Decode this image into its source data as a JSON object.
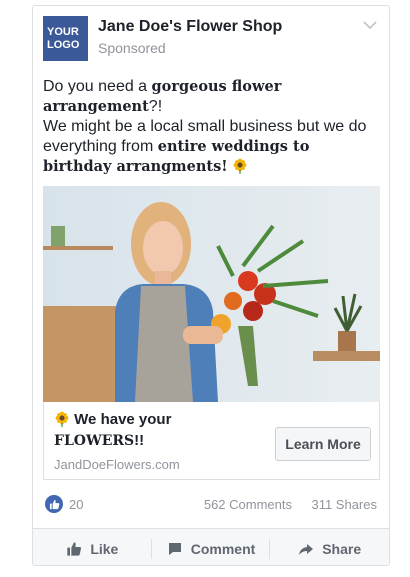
{
  "ad": {
    "logo_line1": "YOUR",
    "logo_line2": "LOGO",
    "page_name": "Jane Doe's Flower Shop",
    "sponsored": "Sponsored",
    "text_1": "Do you need a ",
    "text_1_bold": "gorgeous flower arrangement",
    "text_2": "?!",
    "text_3": "We might be a local small business but we do everything from ",
    "text_3_bold": "entire weddings to birthday arrangments!",
    "headline_1": "We have your",
    "headline_2": "FLOWERS",
    "headline_3": "!!",
    "domain": "JandDoeFlowers.com",
    "cta_label": "Learn More"
  },
  "stats": {
    "likes": "20",
    "comments": "562 Comments",
    "shares": "311 Shares"
  },
  "actions": {
    "like": "Like",
    "comment": "Comment",
    "share": "Share"
  },
  "icons": {
    "logo_color": "#3b5998",
    "like_color": "#4267b2",
    "emoji": "sunflower-icon"
  }
}
